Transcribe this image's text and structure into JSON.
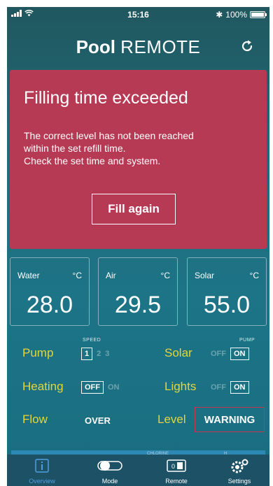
{
  "status_bar": {
    "time": "15:16",
    "bluetooth": "✱",
    "battery": "100%"
  },
  "header": {
    "title_bold": "Pool",
    "title_light": "REMOTE",
    "refresh_icon": "refresh-icon"
  },
  "alert": {
    "title": "Filling time exceeded",
    "message": [
      "The correct level has not been reached",
      "within the set refill time.",
      "Check the set time and system."
    ],
    "button": "Fill again"
  },
  "temps": [
    {
      "name": "Water",
      "unit": "°C",
      "value": "28.0"
    },
    {
      "name": "Air",
      "unit": "°C",
      "value": "29.5"
    },
    {
      "name": "Solar",
      "unit": "°C",
      "value": "55.0"
    }
  ],
  "controls": {
    "pump": {
      "label": "Pump",
      "caption": "SPEED",
      "speeds": [
        "1",
        "2",
        "3"
      ]
    },
    "solar": {
      "label": "Solar",
      "caption": "PUMP",
      "off": "OFF",
      "on": "ON"
    },
    "heating": {
      "label": "Heating",
      "off": "OFF",
      "on": "ON"
    },
    "lights": {
      "label": "Lights",
      "off": "OFF",
      "on": "ON"
    },
    "flow": {
      "label": "Flow",
      "value": "OVER"
    },
    "level": {
      "label": "Level",
      "value": "WARNING"
    }
  },
  "strip": {
    "caption1": "CHLORINE",
    "caption2": "H"
  },
  "tabs": [
    {
      "label": "Overview",
      "icon": "info-icon",
      "active": true
    },
    {
      "label": "Mode",
      "icon": "toggle-icon",
      "active": false
    },
    {
      "label": "Remote",
      "icon": "remote-icon",
      "active": false
    },
    {
      "label": "Settings",
      "icon": "gear-icon",
      "active": false
    }
  ],
  "colors": {
    "accent_yellow": "#e3d63b",
    "alert_red": "#b73a55",
    "warning_border": "#c8334f",
    "active_tab": "#4e9fdf"
  }
}
